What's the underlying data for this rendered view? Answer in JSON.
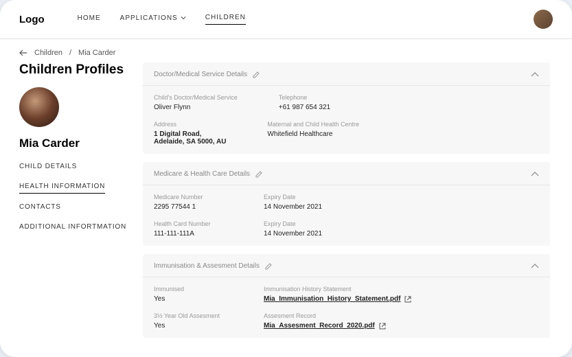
{
  "header": {
    "logo": "Logo",
    "nav": {
      "home": "HOME",
      "applications": "APPLICATIONS",
      "children": "CHILDREN"
    }
  },
  "breadcrumb": {
    "root": "Children",
    "sep": "/",
    "current": "Mia Carder"
  },
  "page_title": "Children Profiles",
  "child": {
    "name": "Mia Carder"
  },
  "tabs": {
    "details": "CHILD DETAILS",
    "health": "HEALTH INFORMATION",
    "contacts": "CONTACTS",
    "additional": "ADDITIONAL INFORTMATION"
  },
  "sections": {
    "doctor": {
      "title": "Doctor/Medical Service Details",
      "fields": {
        "service_label": "Child's Doctor/Medical Service",
        "service_value": "Oliver Flynn",
        "phone_label": "Telephone",
        "phone_value": "+61 987 654 321",
        "address_label": "Address",
        "address_value": "1 Digital Road,\nAdelaide, SA 5000, AU",
        "centre_label": "Maternal and Child Health Centre",
        "centre_value": "Whitefield Healthcare"
      }
    },
    "medicare": {
      "title": "Medicare & Health Care Details",
      "fields": {
        "medicare_label": "Medicare Number",
        "medicare_value": "2295 77544 1",
        "expiry1_label": "Expiry Date",
        "expiry1_value": "14 November 2021",
        "healthcard_label": "Health Card Number",
        "healthcard_value": "111-111-111A",
        "expiry2_label": "Expiry Date",
        "expiry2_value": "14 November 2021"
      }
    },
    "immunisation": {
      "title": "Immunisation & Assesment Details",
      "fields": {
        "immunised_label": "Immunised",
        "immunised_value": "Yes",
        "history_label": "Immunisation History Statement",
        "history_value": "Mia_Immunisation_History_Statement.pdf",
        "assesment_label": "3½ Year Old Assesment",
        "assesment_value": "Yes",
        "record_label": "Assesment Record",
        "record_value": "Mia_Assesment_Record_2020.pdf"
      }
    }
  }
}
